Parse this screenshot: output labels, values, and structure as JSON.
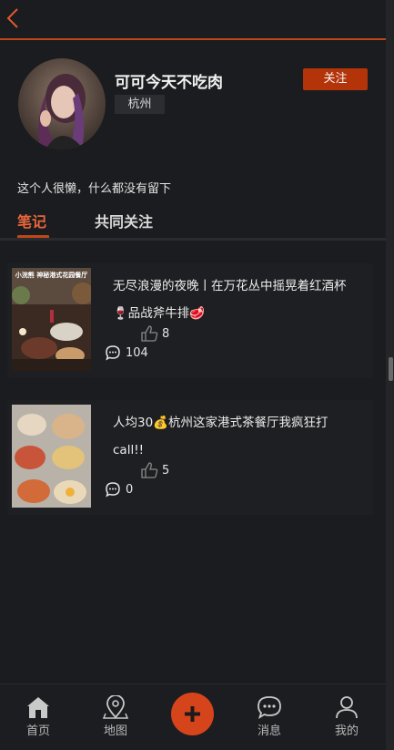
{
  "header": {
    "back_icon": "chevron-left-icon",
    "accent": "#c0461a"
  },
  "profile": {
    "username": "可可今天不吃肉",
    "city": "杭州",
    "follow_label": "关注",
    "bio": "这个人很懒，什么都没有留下",
    "follow_color": "#b4340a"
  },
  "tabs": [
    {
      "label": "笔记",
      "active": true
    },
    {
      "label": "共同关注",
      "active": false
    }
  ],
  "notes": [
    {
      "title": "无尽浪漫的夜晚丨在万花丛中摇晃着红酒杯🍷品战斧牛排🥩",
      "likes": "8",
      "comments": "104",
      "thumbnail_caption": "小浣熊 神秘港式花园餐厅"
    },
    {
      "title": "人均30💰杭州这家港式茶餐厅我疯狂打call!!",
      "likes": "5",
      "comments": "0"
    }
  ],
  "bottom_nav": [
    {
      "label": "首页",
      "icon": "home-icon"
    },
    {
      "label": "地图",
      "icon": "map-pin-icon"
    },
    {
      "label": "",
      "icon": "plus-icon"
    },
    {
      "label": "消息",
      "icon": "message-icon"
    },
    {
      "label": "我的",
      "icon": "user-icon"
    }
  ]
}
